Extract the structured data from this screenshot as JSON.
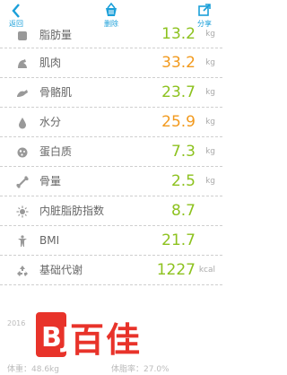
{
  "toolbar": {
    "back_label": "返回",
    "delete_label": "删除",
    "share_label": "分享",
    "accent": "#1a9fd9"
  },
  "metrics": [
    {
      "name": "脂肪量",
      "value": "13.2",
      "unit": "kg",
      "icon": "fat-mass-icon",
      "color": "green"
    },
    {
      "name": "肌肉",
      "value": "33.2",
      "unit": "kg",
      "icon": "muscle-icon",
      "color": "orange"
    },
    {
      "name": "骨骼肌",
      "value": "23.7",
      "unit": "kg",
      "icon": "skeletal-muscle-icon",
      "color": "green"
    },
    {
      "name": "水分",
      "value": "25.9",
      "unit": "kg",
      "icon": "water-drop-icon",
      "color": "orange"
    },
    {
      "name": "蛋白质",
      "value": "7.3",
      "unit": "kg",
      "icon": "protein-icon",
      "color": "green"
    },
    {
      "name": "骨量",
      "value": "2.5",
      "unit": "kg",
      "icon": "bone-icon",
      "color": "green"
    },
    {
      "name": "内脏脂肪指数",
      "value": "8.7",
      "unit": "",
      "icon": "visceral-fat-icon",
      "color": "green"
    },
    {
      "name": "BMI",
      "value": "21.7",
      "unit": "",
      "icon": "bmi-icon",
      "color": "green"
    },
    {
      "name": "基础代谢",
      "value": "1227",
      "unit": "kcal",
      "icon": "metabolism-icon",
      "color": "green"
    }
  ],
  "footer": {
    "year_fragment": "2016",
    "weight_text": "体重：48.6kg",
    "fat_text": "体脂率：27.0%"
  },
  "watermark": {
    "brand": "百佳"
  },
  "colors": {
    "orange": "#f29a1e",
    "green": "#8dc21f"
  }
}
